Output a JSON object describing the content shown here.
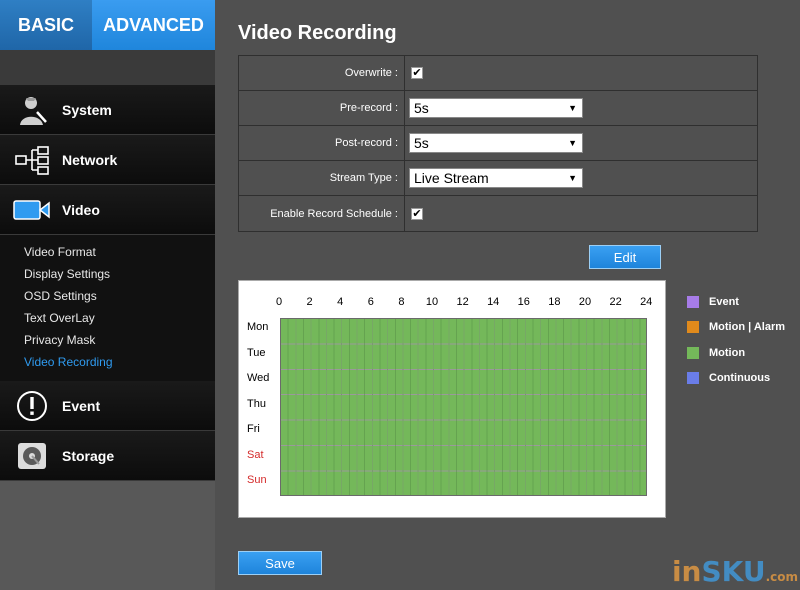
{
  "tabs": {
    "basic": "BASIC",
    "advanced": "ADVANCED"
  },
  "menu": {
    "system": "System",
    "network": "Network",
    "video": "Video",
    "video_sub": [
      "Video Format",
      "Display Settings",
      "OSD Settings",
      "Text OverLay",
      "Privacy Mask",
      "Video Recording"
    ],
    "event": "Event",
    "storage": "Storage"
  },
  "page": {
    "title": "Video Recording"
  },
  "form": {
    "overwrite_label": "Overwrite :",
    "overwrite_checked": true,
    "prerecord_label": "Pre-record :",
    "prerecord_value": "5s",
    "postrecord_label": "Post-record :",
    "postrecord_value": "5s",
    "streamtype_label": "Stream Type :",
    "streamtype_value": "Live Stream",
    "schedule_label": "Enable Record Schedule :",
    "schedule_checked": true
  },
  "buttons": {
    "edit": "Edit",
    "save": "Save"
  },
  "schedule": {
    "hours": [
      "0",
      "2",
      "4",
      "6",
      "8",
      "10",
      "12",
      "14",
      "16",
      "18",
      "20",
      "22",
      "24"
    ],
    "days": [
      "Mon",
      "Tue",
      "Wed",
      "Thu",
      "Fri",
      "Sat",
      "Sun"
    ],
    "fill_mode": "Motion",
    "fill_color": "#74b85a"
  },
  "legend": [
    {
      "label": "Event",
      "color": "#a77ce8"
    },
    {
      "label": "Motion | Alarm",
      "color": "#e08a1c"
    },
    {
      "label": "Motion",
      "color": "#74b85a"
    },
    {
      "label": "Continuous",
      "color": "#6a7de8"
    }
  ],
  "colors": {
    "accent": "#2f9bf0",
    "weekend": "#d42a2a"
  },
  "watermark": {
    "part1": "in",
    "part2": "SKU",
    "part3": ".com"
  }
}
